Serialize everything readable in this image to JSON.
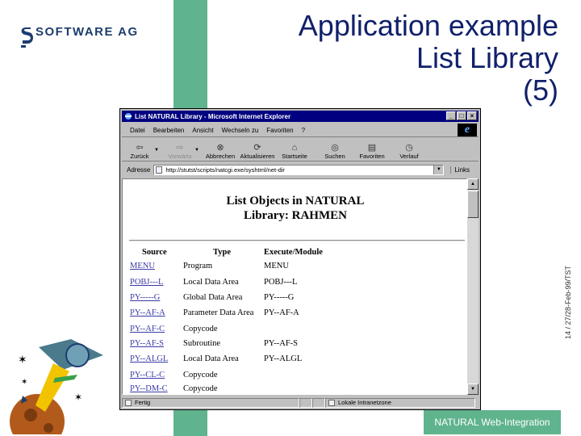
{
  "slide": {
    "logo_text": "SOFTWARE AG",
    "title_lines": [
      "Application example",
      "List Library",
      "(5)"
    ],
    "side_stamp": "14 / 27/28-Feb-99/TST",
    "footer": "NATURAL Web-Integration",
    "accent_color": "#5fb38d",
    "title_color": "#10206a"
  },
  "browser": {
    "title": "List NATURAL Library - Microsoft Internet Explorer",
    "menu": [
      "Datei",
      "Bearbeiten",
      "Ansicht",
      "Wechseln zu",
      "Favoriten",
      "?"
    ],
    "toolbar": [
      {
        "label": "Zurück",
        "icon": "back-arrow-icon",
        "disabled": false
      },
      {
        "label": "Vorwärts",
        "icon": "forward-arrow-icon",
        "disabled": true
      },
      {
        "label": "Abbrechen",
        "icon": "stop-icon",
        "disabled": false
      },
      {
        "label": "Aktualisieren",
        "icon": "refresh-icon",
        "disabled": false
      },
      {
        "label": "Startseite",
        "icon": "home-icon",
        "disabled": false
      },
      {
        "label": "Suchen",
        "icon": "search-icon",
        "disabled": false
      },
      {
        "label": "Favoriten",
        "icon": "favorites-icon",
        "disabled": false
      },
      {
        "label": "Verlauf",
        "icon": "history-icon",
        "disabled": false
      }
    ],
    "address_label": "Adresse",
    "address_value": "http://stutst/scripts/natcgi.exe/syshtml/net-dir",
    "links_label": "Links",
    "status_left": "Fertig",
    "status_zone": "Lokale Intranetzone"
  },
  "page": {
    "heading_line1": "List Objects in NATURAL",
    "heading_line2": "Library: RAHMEN",
    "columns": [
      "Source",
      "Type",
      "Execute/Module"
    ],
    "rows": [
      {
        "source": "MENU",
        "type": "Program",
        "execute": "MENU"
      },
      {
        "source": "POBJ---L",
        "type": "Local Data Area",
        "execute": "POBJ---L"
      },
      {
        "source": "PY-----G",
        "type": "Global Data Area",
        "execute": "PY-----G"
      },
      {
        "source": "PY--AF-A",
        "type": "Parameter Data Area",
        "execute": "PY--AF-A"
      },
      {
        "source": "PY--AF-C",
        "type": "Copycode",
        "execute": ""
      },
      {
        "source": "PY--AF-S",
        "type": "Subroutine",
        "execute": "PY--AF-S"
      },
      {
        "source": "PY--ALGL",
        "type": "Local Data Area",
        "execute": "PY--ALGL"
      },
      {
        "source": "PY--CL-C",
        "type": "Copycode",
        "execute": ""
      },
      {
        "source": "PY--DM-C",
        "type": "Copycode",
        "execute": ""
      }
    ]
  }
}
